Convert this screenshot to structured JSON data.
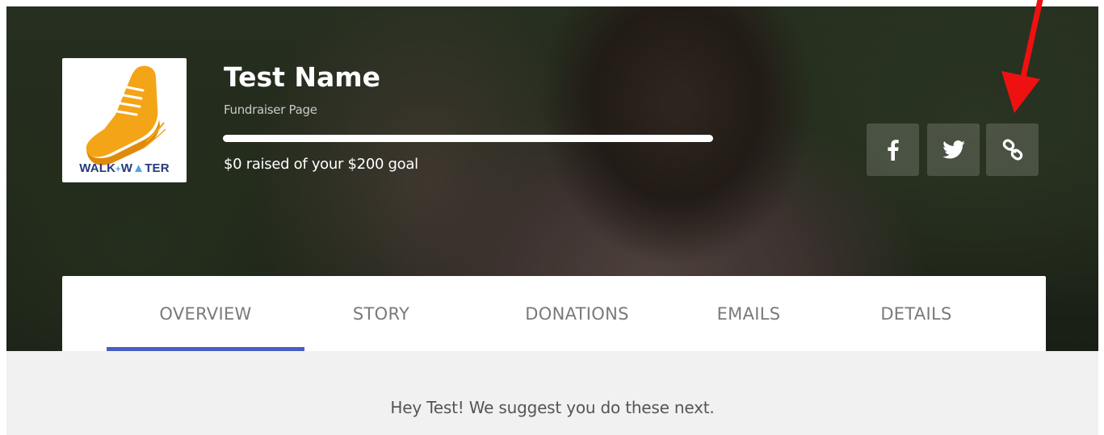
{
  "header": {
    "logo_text": "WALK4WATER",
    "name": "Test Name",
    "subtitle": "Fundraiser Page",
    "raised_text": "$0 raised of your $200 goal",
    "progress": 0,
    "share": {
      "facebook_icon": "facebook-icon",
      "twitter_icon": "twitter-icon",
      "link_icon": "link-icon"
    }
  },
  "tabs": [
    {
      "label": "OVERVIEW",
      "active": true
    },
    {
      "label": "STORY",
      "active": false
    },
    {
      "label": "DONATIONS",
      "active": false
    },
    {
      "label": "EMAILS",
      "active": false
    },
    {
      "label": "DETAILS",
      "active": false
    }
  ],
  "content": {
    "suggestion": "Hey Test! We suggest you do these next."
  },
  "colors": {
    "accent": "#4a5ec2",
    "annotation": "#ee1111",
    "logo_orange": "#f4a417",
    "logo_navy": "#263a78"
  }
}
